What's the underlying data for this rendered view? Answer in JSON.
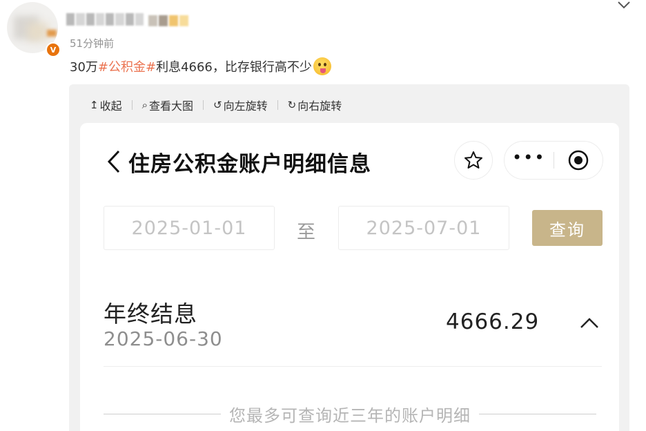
{
  "post": {
    "time": "51分钟前",
    "verified_badge": "V",
    "text_prefix": "30万",
    "hashtag": "#公积金#",
    "text_suffix": "利息4666，比存银行高不少",
    "emoji": "tongue-out-face-emoji"
  },
  "viewer": {
    "toolbar": [
      {
        "icon": "↥",
        "label": "收起"
      },
      {
        "icon": "⌕",
        "label": "查看大图"
      },
      {
        "icon": "↺",
        "label": "向左旋转"
      },
      {
        "icon": "↻",
        "label": "向右旋转"
      }
    ]
  },
  "app": {
    "title": "住房公积金账户明细信息",
    "date_from": "2025-01-01",
    "date_separator": "至",
    "date_to": "2025-07-01",
    "query_label": "查询",
    "query_color": "#c8b58a",
    "record": {
      "title": "年终结息",
      "date": "2025-06-30",
      "amount": "4666.29"
    },
    "notice": "您最多可查询近三年的账户明细"
  },
  "colors": {
    "hashtag": "#eb7350",
    "badge": "#e8730c"
  }
}
